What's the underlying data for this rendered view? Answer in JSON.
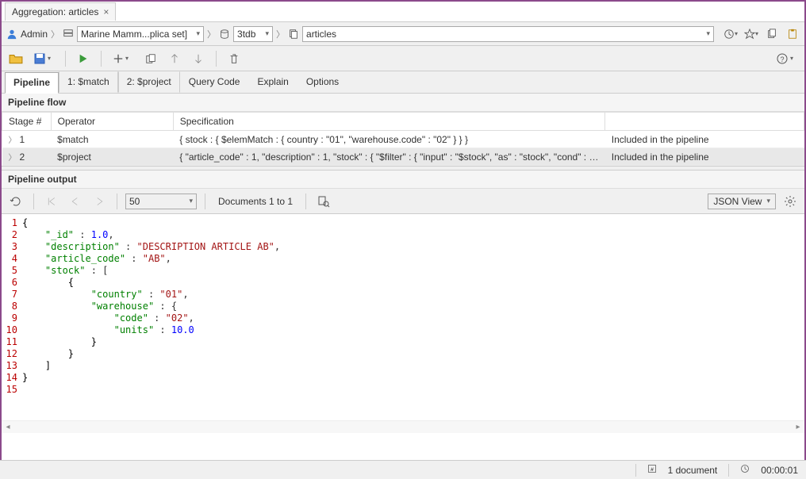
{
  "tab": {
    "title": "Aggregation: articles"
  },
  "breadcrumb": {
    "user": "Admin",
    "replica": "Marine Mamm...plica set]",
    "database": "3tdb",
    "collection": "articles"
  },
  "subtabs": {
    "pipeline": "Pipeline",
    "match": "1: $match",
    "project": "2: $project",
    "query": "Query Code",
    "explain": "Explain",
    "options": "Options"
  },
  "pipelineFlow": {
    "header": "Pipeline flow",
    "cols": {
      "stage": "Stage #",
      "operator": "Operator",
      "spec": "Specification",
      "included": ""
    },
    "rows": [
      {
        "stage": "1",
        "operator": "$match",
        "spec": "{ stock : { $elemMatch : { country : \"01\", \"warehouse.code\" : \"02\" } } }",
        "included": "Included in the pipeline"
      },
      {
        "stage": "2",
        "operator": "$project",
        "spec": "{ \"article_code\" : 1, \"description\" : 1, \"stock\" : { \"$filter\" : { \"input\" : \"$stock\", \"as\" : \"stock\", \"cond\" : { \"$a...",
        "included": "Included in the pipeline"
      }
    ]
  },
  "output": {
    "header": "Pipeline output",
    "pageSize": "50",
    "range": "Documents 1 to 1",
    "view": "JSON View",
    "code": {
      "l1": "{",
      "l2a": "\"_id\"",
      "l2b": " : ",
      "l2c": "1.0",
      "l2d": ",",
      "l3a": "\"description\"",
      "l3b": " : ",
      "l3c": "\"DESCRIPTION ARTICLE AB\"",
      "l3d": ",",
      "l4a": "\"article_code\"",
      "l4b": " : ",
      "l4c": "\"AB\"",
      "l4d": ",",
      "l5a": "\"stock\"",
      "l5b": " : [",
      "l6": "{",
      "l7a": "\"country\"",
      "l7b": " : ",
      "l7c": "\"01\"",
      "l7d": ",",
      "l8a": "\"warehouse\"",
      "l8b": " : {",
      "l9a": "\"code\"",
      "l9b": " : ",
      "l9c": "\"02\"",
      "l9d": ",",
      "l10a": "\"units\"",
      "l10b": " : ",
      "l10c": "10.0",
      "l11": "}",
      "l12": "}",
      "l13": "]",
      "l14": "}"
    }
  },
  "status": {
    "docs": "1 document",
    "time": "00:00:01"
  }
}
